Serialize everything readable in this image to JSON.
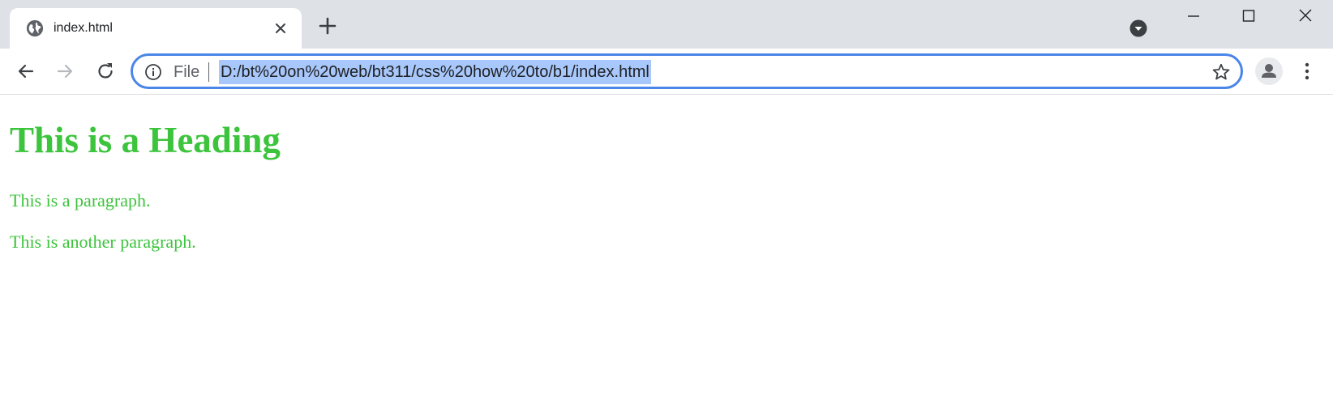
{
  "browser": {
    "tab": {
      "title": "index.html",
      "favicon": "globe-icon"
    },
    "omnibox": {
      "scheme_label": "File",
      "url": "D:/bt%20on%20web/bt311/css%20how%20to/b1/index.html",
      "url_selected": true
    },
    "icons": {
      "tab_close": "close-icon",
      "new_tab": "plus-icon",
      "tab_search": "chevron-down-circle-icon",
      "minimize": "minimize-icon",
      "maximize": "maximize-icon",
      "close_window": "close-icon",
      "back": "arrow-left-icon",
      "forward": "arrow-right-icon",
      "reload": "reload-icon",
      "site_info": "info-icon",
      "bookmark": "star-icon",
      "profile": "person-icon",
      "menu": "more-vertical-icon"
    },
    "colors": {
      "tabstrip_bg": "#dee1e6",
      "omnibox_focus_border": "#4a86e8",
      "selection_bg": "#a8c7fa"
    }
  },
  "page": {
    "heading": "This is a Heading",
    "paragraphs": [
      "This is a paragraph.",
      "This is another paragraph."
    ],
    "text_color": "#3cc43c"
  }
}
